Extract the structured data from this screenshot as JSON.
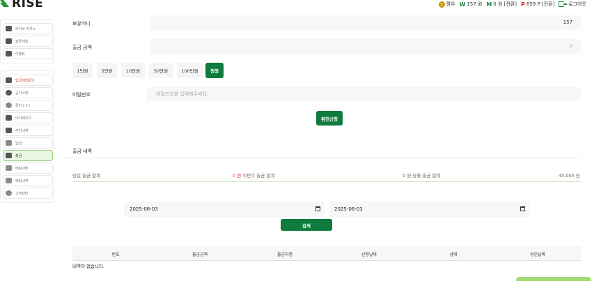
{
  "header": {
    "logo_text": "RISE",
    "rank_label": "평우",
    "money_symbol": "W",
    "money_value": "157 원",
    "mileage_symbol": "M",
    "mileage_value": "0 원 [전환]",
    "point_symbol": "P",
    "point_value": "659 P [전환]",
    "logout_label": "로그아웃"
  },
  "sidebar": {
    "group1": [
      {
        "label": "라이브 카지노",
        "icon": "casino-icon"
      },
      {
        "label": "슬롯게임",
        "icon": "slot-icon"
      },
      {
        "label": "이벤트",
        "icon": "event-icon"
      }
    ],
    "group2": [
      {
        "label": "입금계좌문의",
        "icon": "bank-icon"
      },
      {
        "label": "공지사항",
        "icon": "notice-icon"
      },
      {
        "label": "쪽지 ( 0 )",
        "icon": "message-icon"
      },
      {
        "label": "마이페이지",
        "icon": "user-icon"
      },
      {
        "label": "추천내역",
        "icon": "recommend-icon"
      },
      {
        "label": "입금",
        "icon": "deposit-icon"
      },
      {
        "label": "출금",
        "icon": "withdraw-icon"
      },
      {
        "label": "베팅내역",
        "icon": "bet-history-icon"
      },
      {
        "label": "배팅내역",
        "icon": "betting-icon"
      },
      {
        "label": "고객센터",
        "icon": "support-icon"
      }
    ]
  },
  "form": {
    "balance_label": "보유머니",
    "balance_value": "157",
    "withdraw_label": "출금 금액",
    "withdraw_value": "0",
    "amount_buttons": [
      "1만원",
      "5만원",
      "10만원",
      "50만원",
      "100만원"
    ],
    "reset_label": "정정",
    "password_label": "비밀번호",
    "password_placeholder": "비밀번호를 입력해주세요.",
    "submit_label": "환전신청"
  },
  "history": {
    "title": "출금 내역",
    "today_label": "당일 출금 합계",
    "today_value": "0 원",
    "week_label": "이번주 출금 합계",
    "month_value": "0 원",
    "month_label": "당월 출금 합계",
    "total_value": "40,000 원",
    "date_from": "2025-06-03",
    "date_to": "2025-06-03",
    "search_label": "검색",
    "columns": [
      "번호",
      "출금금액",
      "출금자명",
      "신청날짜",
      "상태",
      "승인날짜"
    ],
    "empty_message": "내역이 없습니다."
  }
}
